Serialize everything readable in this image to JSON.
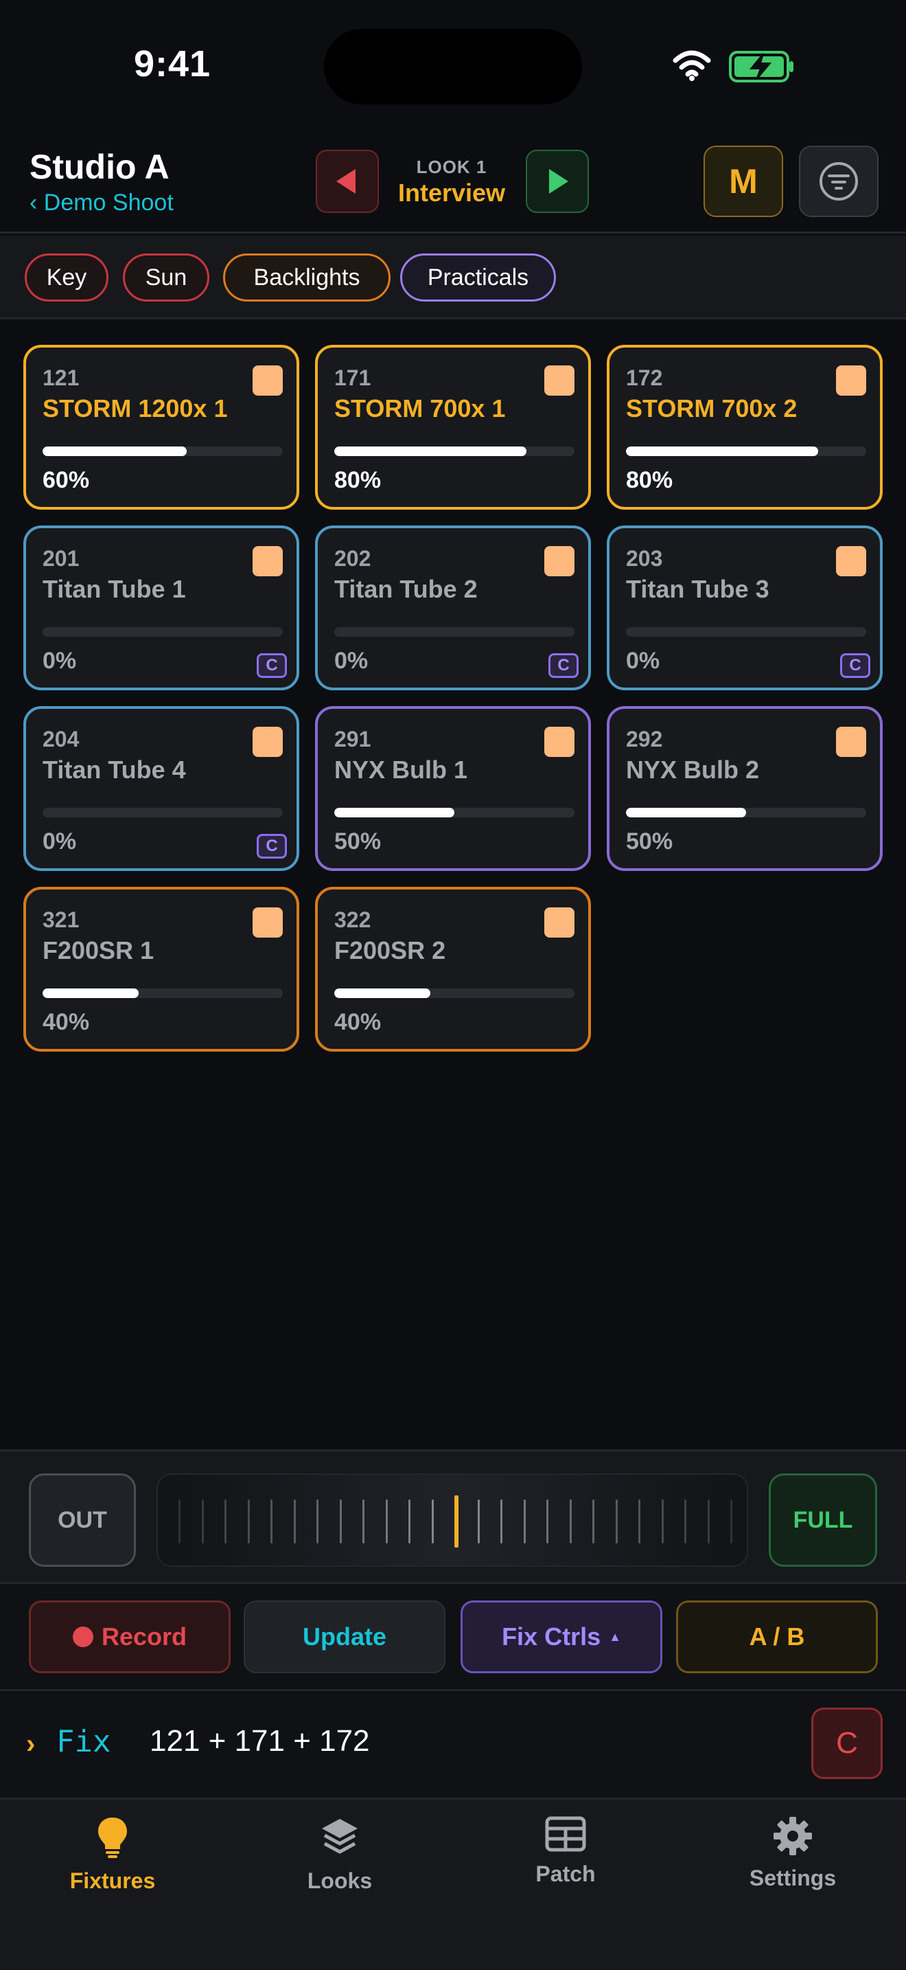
{
  "status_bar": {
    "time": "9:41"
  },
  "header": {
    "title": "Studio A",
    "back_label": "‹ Demo Shoot",
    "look_number": "LOOK 1",
    "look_name": "Interview",
    "master_label": "M"
  },
  "groups": [
    "Key",
    "Sun",
    "Backlights",
    "Practicals"
  ],
  "colors": {
    "accent": "#f5b026",
    "cyan": "#19c3d6",
    "group_red": "#c7363f",
    "group_yellow": "#f5b026",
    "group_blue": "#4d9ac3",
    "group_purple": "#8a6ad4",
    "group_orange": "#d87a1e"
  },
  "fixtures": [
    {
      "id": "121",
      "name": "STORM 1200x 1",
      "level": 60,
      "level_text": "60%",
      "on": true,
      "color_mode": false
    },
    {
      "id": "171",
      "name": "STORM 700x 1",
      "level": 80,
      "level_text": "80%",
      "on": true,
      "color_mode": false
    },
    {
      "id": "172",
      "name": "STORM 700x 2",
      "level": 80,
      "level_text": "80%",
      "on": true,
      "color_mode": false
    },
    {
      "id": "201",
      "name": "Titan Tube 1",
      "level": 0,
      "level_text": "0%",
      "on": false,
      "color_mode": true
    },
    {
      "id": "202",
      "name": "Titan Tube 2",
      "level": 0,
      "level_text": "0%",
      "on": false,
      "color_mode": true
    },
    {
      "id": "203",
      "name": "Titan Tube 3",
      "level": 0,
      "level_text": "0%",
      "on": false,
      "color_mode": true
    },
    {
      "id": "204",
      "name": "Titan Tube 4",
      "level": 0,
      "level_text": "0%",
      "on": false,
      "color_mode": true
    },
    {
      "id": "291",
      "name": "NYX Bulb 1",
      "level": 50,
      "level_text": "50%",
      "on": false,
      "color_mode": false
    },
    {
      "id": "292",
      "name": "NYX Bulb 2",
      "level": 50,
      "level_text": "50%",
      "on": false,
      "color_mode": false
    },
    {
      "id": "321",
      "name": "F200SR 1",
      "level": 40,
      "level_text": "40%",
      "on": false,
      "color_mode": false
    },
    {
      "id": "322",
      "name": "F200SR 2",
      "level": 40,
      "level_text": "40%",
      "on": false,
      "color_mode": false
    }
  ],
  "color_badge_label": "C",
  "fader": {
    "out_label": "OUT",
    "full_label": "FULL"
  },
  "actions": {
    "record": "Record",
    "update": "Update",
    "fix_ctrls": "Fix Ctrls",
    "ab": "A / B"
  },
  "command_line": {
    "prompt": "›",
    "keyword": "Fix",
    "args": "121 + 171 + 172",
    "clear_label": "C"
  },
  "tabs": [
    {
      "label": "Fixtures",
      "icon": "lightbulb-icon",
      "active": true
    },
    {
      "label": "Looks",
      "icon": "layers-icon",
      "active": false
    },
    {
      "label": "Patch",
      "icon": "grid-table-icon",
      "active": false
    },
    {
      "label": "Settings",
      "icon": "gear-icon",
      "active": false
    }
  ]
}
